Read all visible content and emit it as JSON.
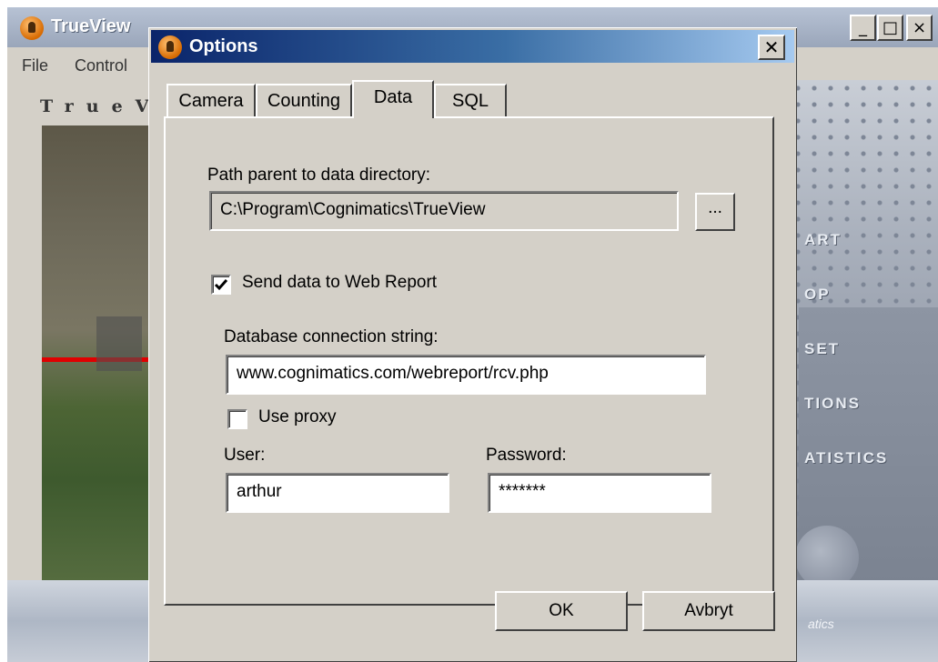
{
  "parent_window": {
    "title": "TrueView",
    "menu": [
      "File",
      "Control"
    ],
    "brand": "TrueV",
    "commands": [
      "ART",
      "OP",
      "SET",
      "TIONS",
      "ATISTICS"
    ],
    "footer": "atics",
    "controls": {
      "minimize": "_",
      "maximize": "□",
      "close": "×"
    }
  },
  "dialog": {
    "title": "Options",
    "close_label": "✕",
    "tabs": [
      {
        "label": "Camera",
        "active": false
      },
      {
        "label": "Counting",
        "active": false
      },
      {
        "label": "Data",
        "active": true
      },
      {
        "label": "SQL",
        "active": false
      }
    ],
    "data_tab": {
      "path_label": "Path parent to data directory:",
      "path_value": "C:\\Program\\Cognimatics\\TrueView",
      "browse_label": "...",
      "send_checkbox": {
        "label": "Send data to Web Report",
        "checked": true
      },
      "db_label": "Database connection string:",
      "db_value": "www.cognimatics.com/webreport/rcv.php",
      "proxy_checkbox": {
        "label": "Use proxy",
        "checked": false
      },
      "user_label": "User:",
      "user_value": "arthur",
      "password_label": "Password:",
      "password_value": "*******"
    },
    "ok_label": "OK",
    "cancel_label": "Avbryt"
  },
  "colors": {
    "dialog_face": "#d4d0c8",
    "titlebar_start": "#0a246a",
    "titlebar_end": "#a6caf0"
  }
}
